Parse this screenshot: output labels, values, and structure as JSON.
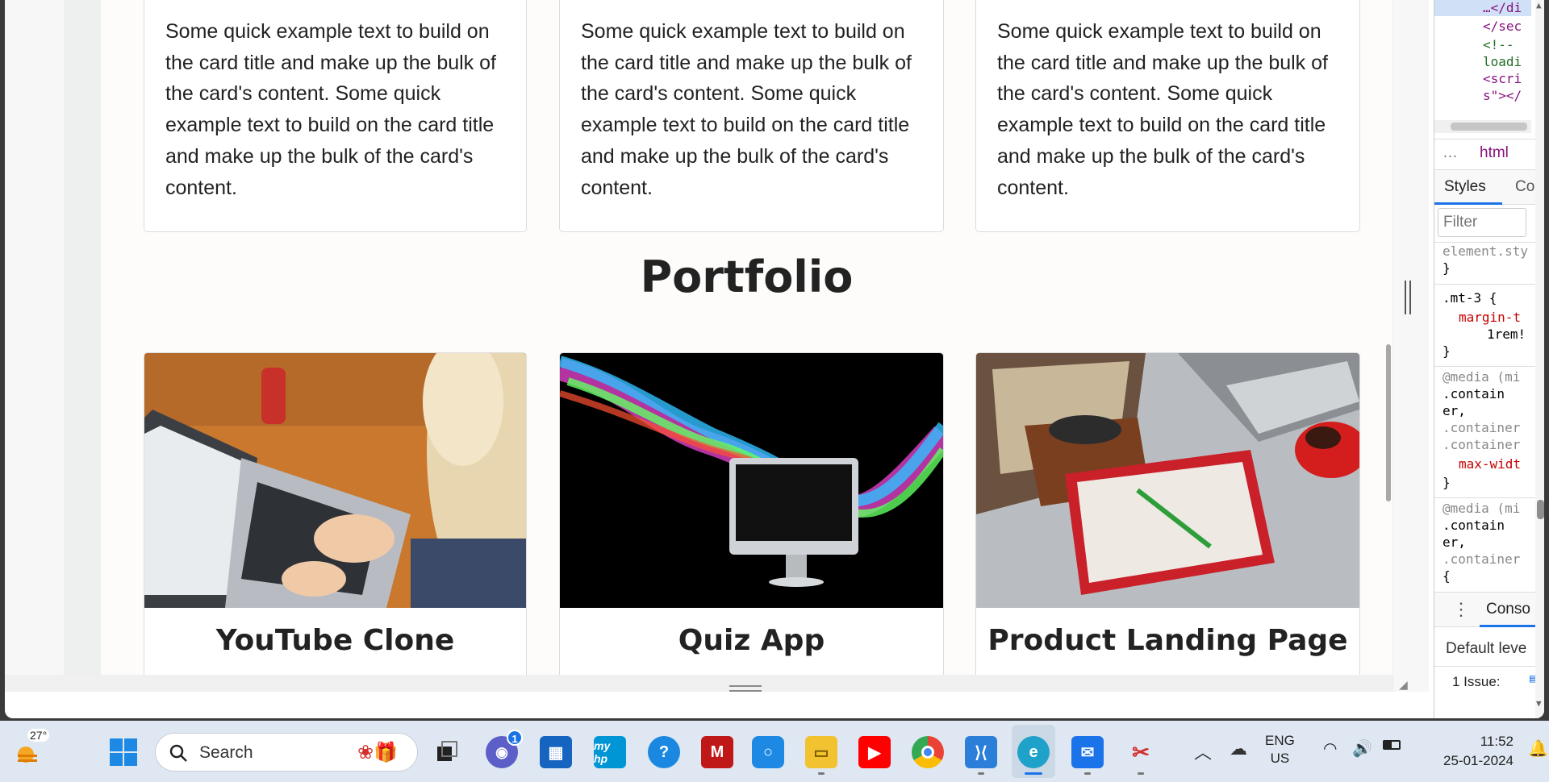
{
  "browser": {
    "cards_top": [
      {
        "text": "Some quick example text to build on the card title and make up the bulk of the card's content. Some quick example text to build on the card title and make up the bulk of the card's content."
      },
      {
        "text": "Some quick example text to build on the card title and make up the bulk of the card's content. Some quick example text to build on the card title and make up the bulk of the card's content."
      },
      {
        "text": "Some quick example text to build on the card title and make up the bulk of the card's content. Some quick example text to build on the card title and make up the bulk of the card's content."
      }
    ],
    "portfolio_heading": "Portfolio",
    "portfolio_cards": [
      {
        "title": "YouTube Clone",
        "image": "laptop-photo"
      },
      {
        "title": "Quiz App",
        "image": "monitor-waves-photo"
      },
      {
        "title": "Product Landing Page",
        "image": "desk-bag-photo"
      }
    ]
  },
  "devtools": {
    "dom_lines": [
      "…</di",
      "</sec",
      "<!--",
      "loadi",
      "<scri",
      "s\"></"
    ],
    "breadcrumb_more": "…",
    "breadcrumb": "html",
    "tabs": [
      "Styles",
      "Co"
    ],
    "filter_placeholder": "Filter",
    "css_lines": [
      "element.sty",
      "}",
      ".mt-3 {",
      "margin-t",
      "1rem!",
      "}",
      "@media (mi",
      ".contain",
      "er,",
      ".container",
      ".container",
      "max-widt",
      "}",
      "@media (mi",
      ".contain",
      "er,",
      ".container",
      "{"
    ],
    "console_tab": "Conso",
    "default_levels": "Default leve",
    "issues": "1 Issue:"
  },
  "taskbar": {
    "weather_temp": "27°",
    "search_label": "Search",
    "chat_badge": "1",
    "language_top": "ENG",
    "language_bottom": "US",
    "time": "11:52",
    "date": "25-01-2024"
  },
  "colors": {
    "vscode": "#2c7fd9",
    "edge": "#1fa2c9",
    "youtube": "#ff0000",
    "mcafee": "#c01818",
    "hp": "#0096d6",
    "store": "#1565c0"
  }
}
